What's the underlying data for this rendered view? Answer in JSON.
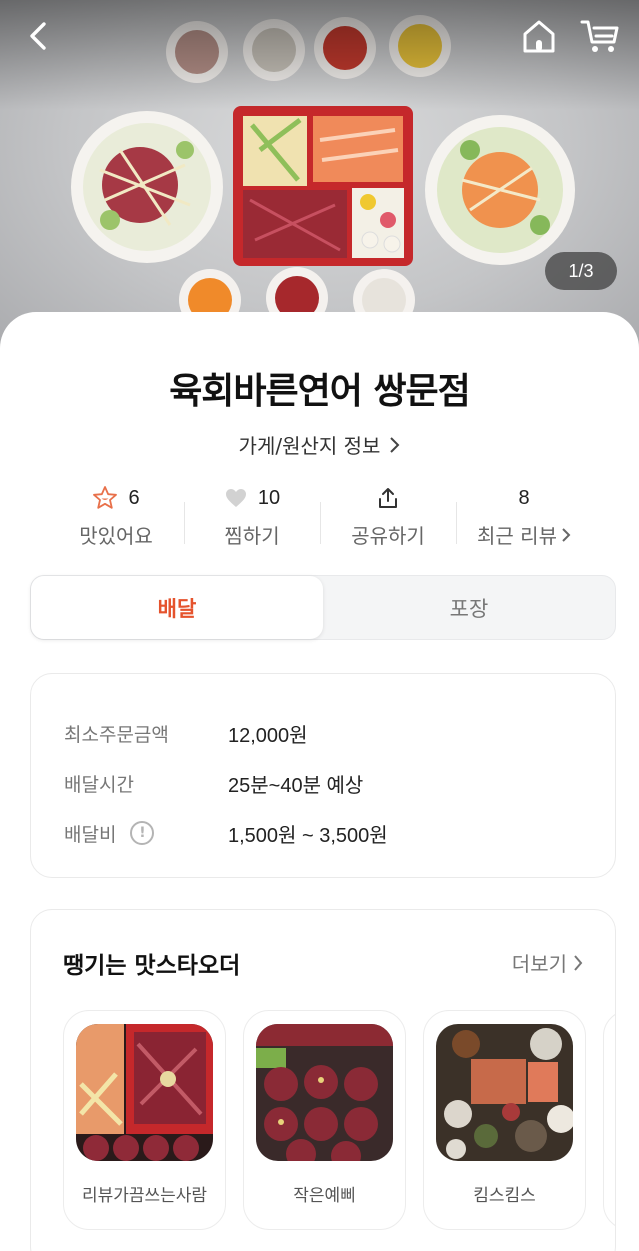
{
  "hero": {
    "pager": "1/3",
    "icons": {
      "back": "back-arrow-icon",
      "home": "home-icon",
      "cart": "cart-icon"
    }
  },
  "store": {
    "name": "육회바른연어 쌍문점",
    "info_link": "가게/원산지 정보"
  },
  "stats": [
    {
      "icon": "star-face-icon",
      "value": "6",
      "label": "맛있어요"
    },
    {
      "icon": "heart-icon",
      "value": "10",
      "label": "찜하기"
    },
    {
      "icon": "share-icon",
      "value": "",
      "label": "공유하기"
    },
    {
      "icon": "",
      "value": "8",
      "label": "최근 리뷰"
    }
  ],
  "tabs": [
    {
      "label": "배달",
      "active": true
    },
    {
      "label": "포장",
      "active": false
    }
  ],
  "delivery": {
    "rows": [
      {
        "label": "최소주문금액",
        "value": "12,000원"
      },
      {
        "label": "배달시간",
        "value": "25분~40분 예상"
      },
      {
        "label": "배달비",
        "value": "1,500원 ~ 3,500원"
      }
    ]
  },
  "reviewers": {
    "title": "땡기는 맛스타오더",
    "more": "더보기",
    "cards": [
      {
        "name": "리뷰가끔쓰는사람"
      },
      {
        "name": "작은예삐"
      },
      {
        "name": "킴스킴스"
      },
      {
        "name": ""
      }
    ]
  },
  "colors": {
    "accent": "#e5532d",
    "star": "#e8704a",
    "heart": "#cfcfcf"
  }
}
